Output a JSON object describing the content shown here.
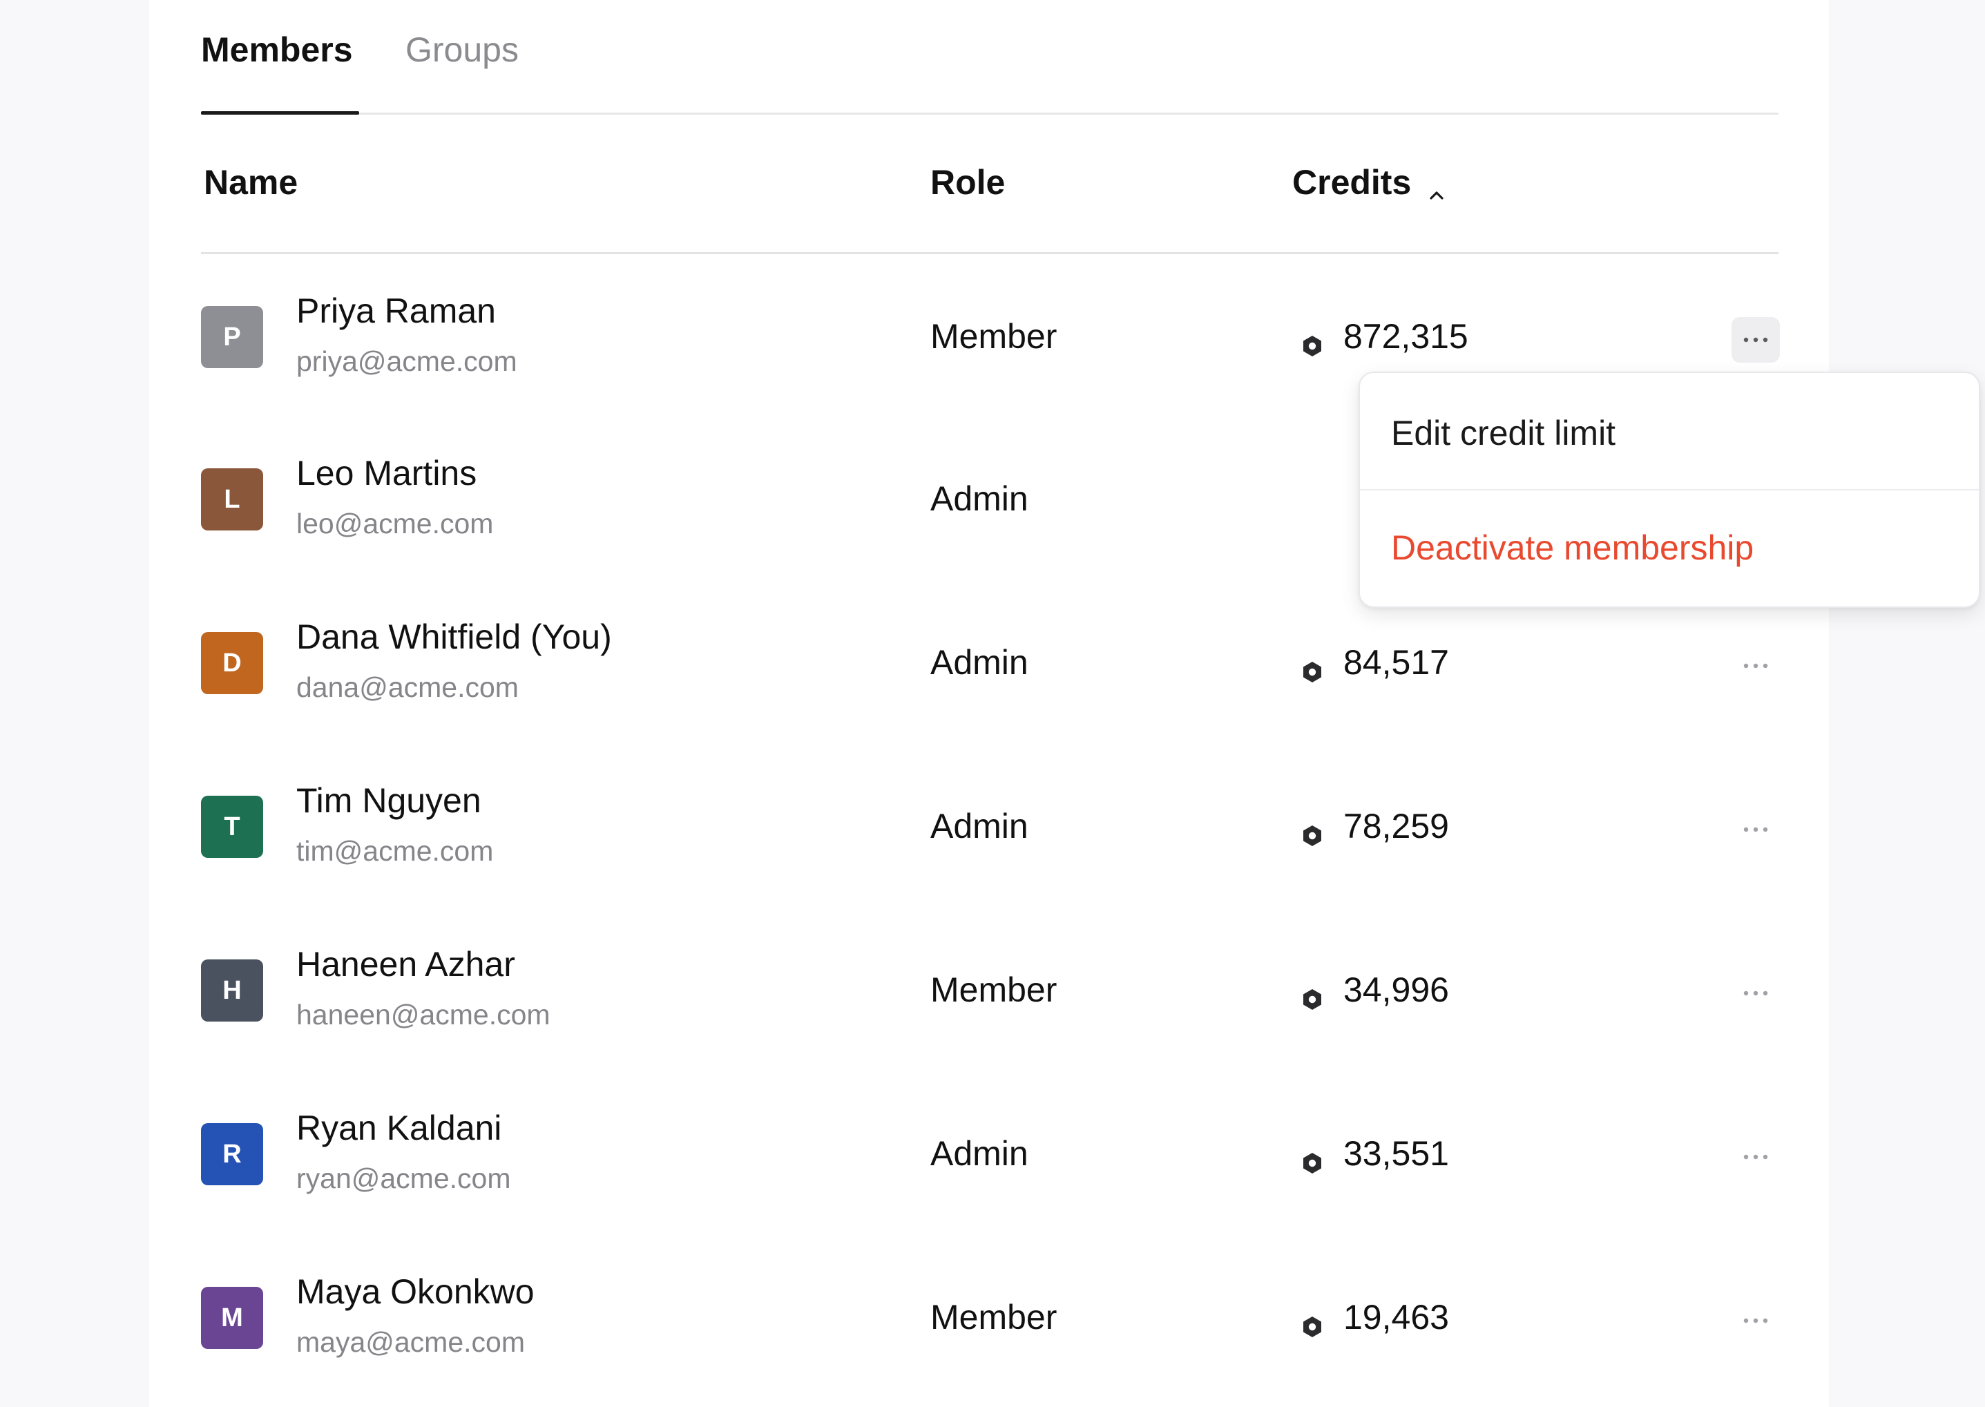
{
  "tabs": [
    {
      "label": "Members",
      "active": true
    },
    {
      "label": "Groups",
      "active": false
    }
  ],
  "table": {
    "columns": {
      "name": "Name",
      "role": "Role",
      "credits": "Credits"
    },
    "sort": {
      "column": "credits",
      "direction": "chevron-up-icon"
    },
    "rows": [
      {
        "initial": "P",
        "name": "Priya Raman",
        "email": "priya@acme.com",
        "role": "Member",
        "credits": "872,315",
        "avatar_color": "#8e8f94",
        "menu_open": true
      },
      {
        "initial": "L",
        "name": "Leo Martins",
        "email": "leo@acme.com",
        "role": "Admin",
        "credits": "",
        "avatar_color": "#8a573a",
        "menu_open": false
      },
      {
        "initial": "D",
        "name": "Dana Whitfield (You)",
        "email": "dana@acme.com",
        "role": "Admin",
        "credits": "84,517",
        "avatar_color": "#c0661f",
        "menu_open": false
      },
      {
        "initial": "T",
        "name": "Tim Nguyen",
        "email": "tim@acme.com",
        "role": "Admin",
        "credits": "78,259",
        "avatar_color": "#1e7052",
        "menu_open": false
      },
      {
        "initial": "H",
        "name": "Haneen Azhar",
        "email": "haneen@acme.com",
        "role": "Member",
        "credits": "34,996",
        "avatar_color": "#4a5260",
        "menu_open": false
      },
      {
        "initial": "R",
        "name": "Ryan Kaldani",
        "email": "ryan@acme.com",
        "role": "Admin",
        "credits": "33,551",
        "avatar_color": "#2553b5",
        "menu_open": false
      },
      {
        "initial": "M",
        "name": "Maya Okonkwo",
        "email": "maya@acme.com",
        "role": "Member",
        "credits": "19,463",
        "avatar_color": "#6a4594",
        "menu_open": false
      }
    ]
  },
  "row_menu": {
    "items": [
      {
        "label": "Edit credit limit",
        "color": "#1a1a1a"
      },
      {
        "label": "Deactivate membership",
        "color": "#e8492f"
      }
    ]
  },
  "icons": {
    "credits": "hexagon-coin-icon",
    "row_actions": "more-horizontal-icon",
    "sort": "chevron-up-icon"
  }
}
